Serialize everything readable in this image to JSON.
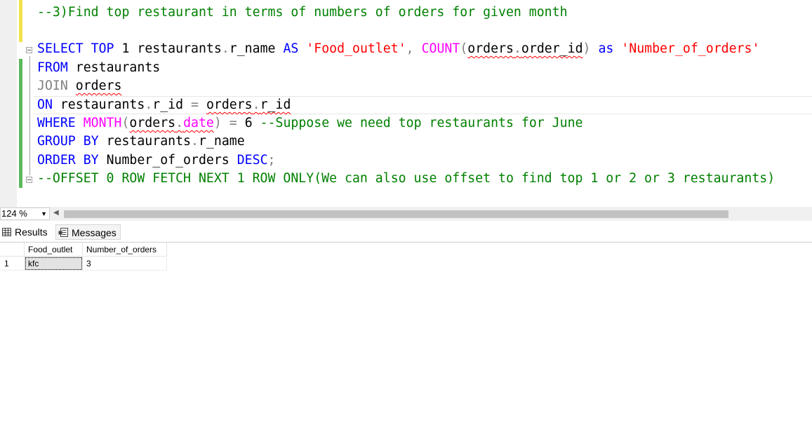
{
  "editor": {
    "comment_line": "--3)Find top restaurant in terms of numbers of orders for given month",
    "tokens": {
      "select": "SELECT",
      "top": "TOP",
      "one": "1",
      "restaurants": "restaurants",
      "dot": ".",
      "r_name": "r_name",
      "as_upper": "AS",
      "food_outlet_str": "'Food_outlet'",
      "comma": ",",
      "count": "COUNT",
      "lparen": "(",
      "orders": "orders",
      "order_id": "order_id",
      "rparen": ")",
      "as_lower": "as",
      "number_of_orders_str": "'Number_of_orders'",
      "from": "FROM",
      "join": "JOIN",
      "on": "ON",
      "r_id": "r_id",
      "eq": "=",
      "where": "WHERE",
      "month": "MONTH",
      "date": "date",
      "six": "6",
      "june_comment": "--Suppose we need top restaurants for June",
      "group": "GROUP",
      "by": "BY",
      "order": "ORDER",
      "number_of_orders": "Number_of_orders",
      "desc": "DESC",
      "semicolon": ";",
      "offset_comment": "--OFFSET 0 ROW FETCH NEXT 1 ROW ONLY(We can also use offset to find top 1 or 2 or 3 restaurants)"
    }
  },
  "zoom": {
    "value": "124 %"
  },
  "tabs": {
    "results": "Results",
    "messages": "Messages"
  },
  "results": {
    "columns": [
      "Food_outlet",
      "Number_of_orders"
    ],
    "rows": [
      {
        "row_number": "1",
        "cells": [
          "kfc",
          "3"
        ]
      }
    ]
  },
  "colors": {
    "keyword": "#0000ff",
    "function": "#ff00ff",
    "string": "#ff0000",
    "comment": "#008000",
    "operator": "#808080",
    "change_bar_saved": "#5cb85c",
    "change_bar_unsaved": "#f1e34a"
  },
  "icons": {
    "results_tab": "grid-icon",
    "messages_tab": "messages-icon",
    "zoom_dropdown": "chevron-down-icon",
    "scroll_left": "scroll-left-arrow-icon",
    "fold": "collapse-icon"
  }
}
